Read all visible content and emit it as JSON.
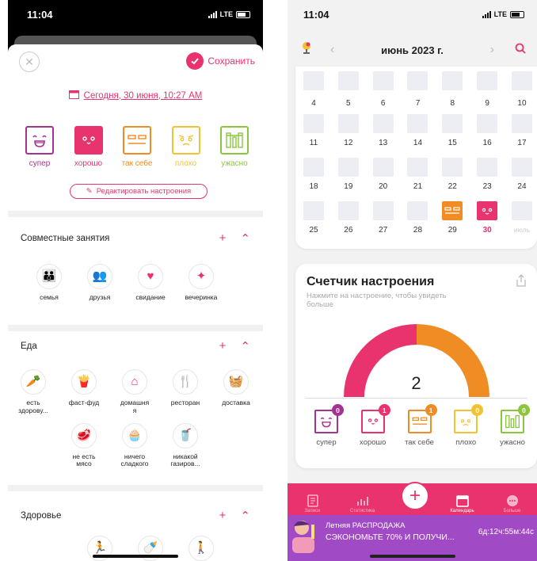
{
  "left": {
    "status": {
      "time": "11:04",
      "network": "LTE"
    },
    "save_label": "Сохранить",
    "date_label": "Сегодня, 30 июня, 10:27 AM",
    "moods": [
      {
        "label": "супер",
        "color": "#a4328f"
      },
      {
        "label": "хорошо",
        "color": "#e8336f"
      },
      {
        "label": "так себе",
        "color": "#ef8c24"
      },
      {
        "label": "плохо",
        "color": "#f2c230"
      },
      {
        "label": "ужасно",
        "color": "#8cc63f"
      }
    ],
    "edit_moods_label": "Редактировать настроения",
    "sections": [
      {
        "title": "Совместные занятия",
        "items": [
          "семья",
          "друзья",
          "свидание",
          "вечеринка"
        ]
      },
      {
        "title": "Еда",
        "items": [
          "есть здорову...",
          "фаст-фуд",
          "домашняя",
          "ресторан",
          "доставка",
          "не есть мясо",
          "ничего сладкого",
          "никакой газиров..."
        ]
      },
      {
        "title": "Здоровье",
        "items": [
          "",
          "",
          ""
        ]
      }
    ]
  },
  "right": {
    "status": {
      "time": "11:04",
      "network": "LTE"
    },
    "month_label": "июнь 2023 г.",
    "calendar_rows": [
      [
        "",
        "",
        "",
        "",
        "",
        "",
        ""
      ],
      [
        "4",
        "5",
        "6",
        "7",
        "8",
        "9",
        "10"
      ],
      [
        "11",
        "12",
        "13",
        "14",
        "15",
        "16",
        "17"
      ],
      [
        "18",
        "19",
        "20",
        "21",
        "22",
        "23",
        "24"
      ],
      [
        "25",
        "26",
        "27",
        "28",
        "29",
        "30",
        "июль"
      ]
    ],
    "counter_title": "Счетчик настроения",
    "counter_subtitle": "Нажмите на настроение, чтобы увидеть больше",
    "count": "2",
    "mood_counts": [
      {
        "label": "супер",
        "count": "0",
        "color": "#a4328f"
      },
      {
        "label": "хорошо",
        "count": "1",
        "color": "#e8336f"
      },
      {
        "label": "так себе",
        "count": "1",
        "color": "#ef8c24"
      },
      {
        "label": "плохо",
        "count": "0",
        "color": "#f2c230"
      },
      {
        "label": "ужасно",
        "count": "0",
        "color": "#8cc63f"
      }
    ],
    "gauge_split": [
      1,
      1
    ],
    "tabs": [
      "Записи",
      "Статистика",
      "",
      "Календарь",
      "Больше"
    ],
    "promo": {
      "line1": "Летняя РАСПРОДАЖА",
      "line2": "СЭКОНОМЬТЕ 70% И ПОЛУЧИ...",
      "timer": "6д:12ч:55м:44с"
    }
  }
}
